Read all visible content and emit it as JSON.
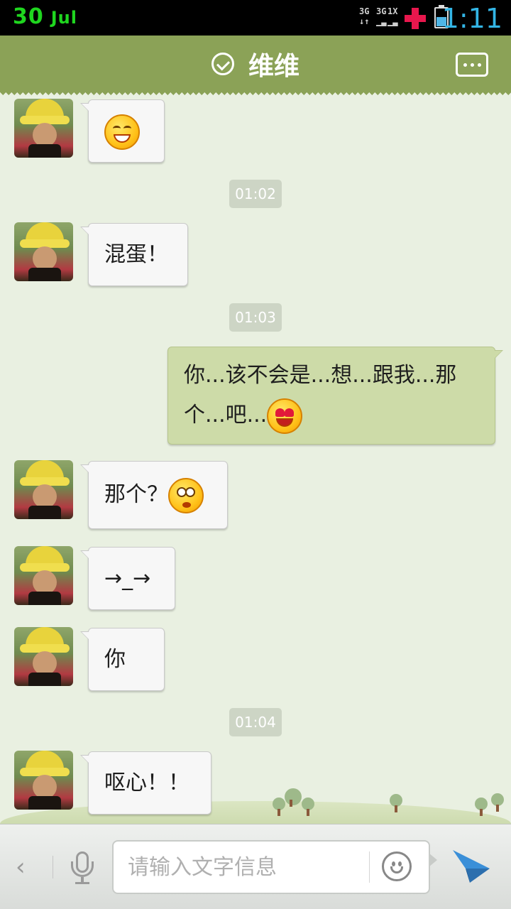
{
  "status_bar": {
    "day": "30",
    "month": "Jul",
    "net_1": "3G",
    "net_2": "3G",
    "net_3": "1X",
    "battery_level_pct": 55,
    "time": "1:11",
    "colors": {
      "date": "#1fd61f",
      "time": "#33b5e5"
    }
  },
  "header": {
    "title": "维维",
    "verified_icon": "check-circle-icon",
    "more_icon": "more-dots-icon",
    "color": "#8ba257"
  },
  "messages": [
    {
      "side": "left",
      "text": "",
      "emoji": "laughing-emoji"
    },
    {
      "type": "time",
      "text": "01:02"
    },
    {
      "side": "left",
      "text": "混蛋！"
    },
    {
      "type": "time",
      "text": "01:03"
    },
    {
      "side": "right",
      "text_line1": "你...该不会是...想...跟我...那",
      "text_line2": "个...吧...",
      "emoji": "heart-eyes-emoji"
    },
    {
      "side": "left",
      "text": "那个？",
      "emoji": "dizzy-emoji"
    },
    {
      "side": "left",
      "text": "→_→"
    },
    {
      "side": "left",
      "text": "你"
    },
    {
      "type": "time",
      "text": "01:04"
    },
    {
      "side": "left",
      "text": "呕心！！"
    }
  ],
  "input_bar": {
    "back_icon": "chevron-left-icon",
    "mic_icon": "microphone-icon",
    "placeholder": "请输入文字信息",
    "emoji_icon": "smiley-icon",
    "send_icon": "paper-plane-icon"
  }
}
